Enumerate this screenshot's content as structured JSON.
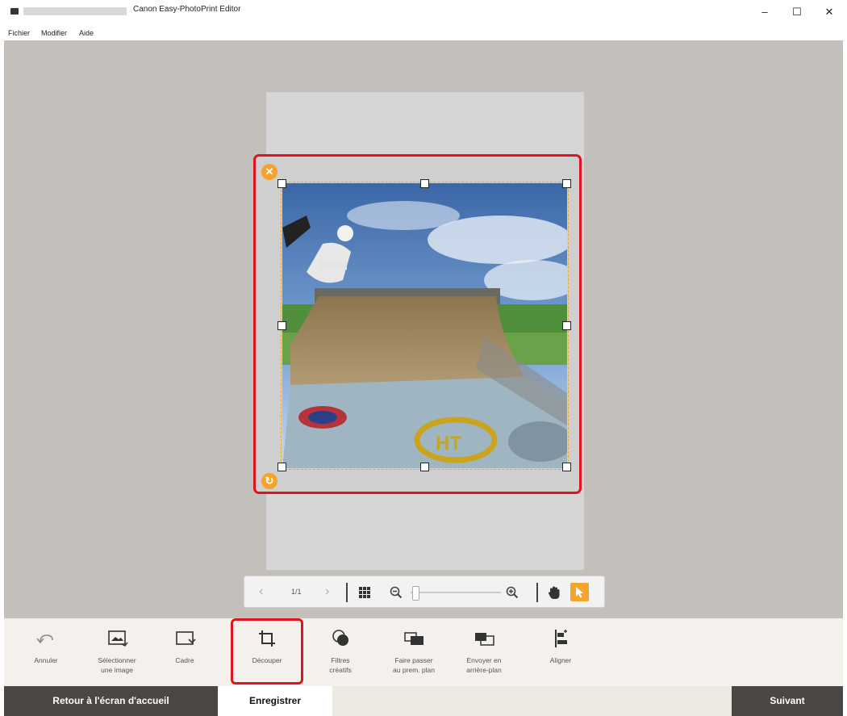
{
  "window": {
    "title": "Canon Easy-PhotoPrint Editor",
    "minimize": "–",
    "maximize": "☐",
    "close": "✕"
  },
  "menu": [
    "Fichier",
    "Modifier",
    "Aide"
  ],
  "pagination": {
    "label": "1/1",
    "prev": "‹",
    "next": "›"
  },
  "zoom": {
    "level": 0.02
  },
  "toolbar": {
    "undo": "Annuler",
    "select_image": "Sélectionner\nune image",
    "frame": "Cadre",
    "crop": "Découper",
    "filters": "Filtres\ncréatifs",
    "bring_front": "Faire passer\nau prem. plan",
    "send_back": "Envoyer en\narrière-plan",
    "align": "Aligner"
  },
  "bottom": {
    "home": "Retour à l'écran d'accueil",
    "save": "Enregistrer",
    "next": "Suivant"
  },
  "colors": {
    "accent": "#f5a32a",
    "highlight": "#e0141e",
    "dark_button": "#4a4744"
  }
}
